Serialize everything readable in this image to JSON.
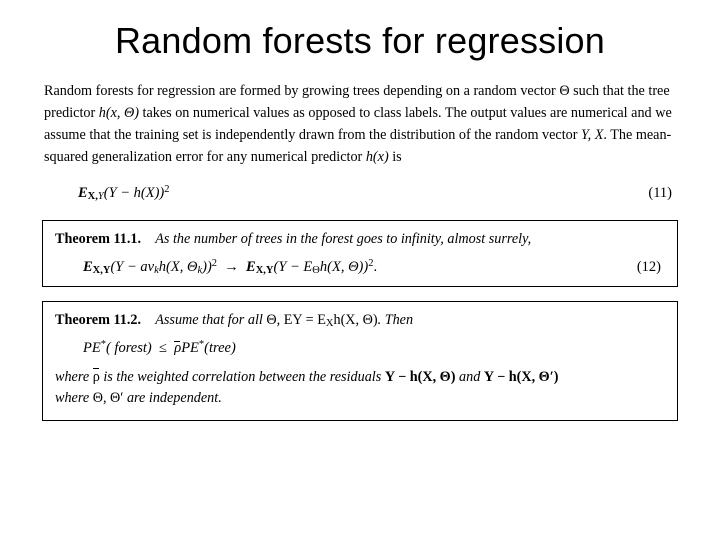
{
  "title": "Random forests for regression",
  "intro": {
    "line1_pre": "Random forests for regression are formed by growing trees depending on a random vector ",
    "theta1": "Θ",
    "line1_mid": " such that the tree predictor ",
    "hxTheta": "h(x, Θ)",
    "line1_post": " takes on numerical values as opposed to class labels. The output values are numerical and we assume that the training set is independently drawn from the distribution of the random vector ",
    "YX": "Y, X",
    "line1_post2": ". The mean-squared generalization error for any numerical predictor ",
    "hx": "h(x)",
    "line1_end": " is"
  },
  "eq11": {
    "lhs_E": "E",
    "lhs_sub1": "X,",
    "lhs_sub2": "Y",
    "body": "(Y − h(X))",
    "sq": "2",
    "num": "(11)"
  },
  "thm11": {
    "label": "Theorem 11.1.",
    "stmt": "As the number of trees in the forest goes to infinity, almost surrely,",
    "eq_lhs_E": "E",
    "eq_lhs_sub": "X,Y",
    "eq_lhs_body": "(Y − av",
    "eq_lhs_k": "k",
    "eq_lhs_body2": "h(X, Θ",
    "eq_lhs_k2": "k",
    "eq_lhs_body3": "))",
    "eq_lhs_sq": "2",
    "arrow": "→",
    "eq_rhs_E": "E",
    "eq_rhs_sub": "X,Y",
    "eq_rhs_body": "(Y − E",
    "eq_rhs_Thsub": "Θ",
    "eq_rhs_body2": "h(X, Θ))",
    "eq_rhs_sq": "2",
    "eq_rhs_end": ".",
    "num": "(12)"
  },
  "thm12": {
    "label": "Theorem 11.2.",
    "stmt_pre": "Assume that for all ",
    "theta": "Θ",
    "stmt_mid": ", ",
    "EY": "EY = E",
    "EY_sub": "X",
    "EY_post": "h(X, Θ)",
    "stmt_post": ". Then",
    "eq_PE": "PE",
    "eq_star": "*",
    "eq_forest": "( forest)",
    "eq_le": "≤",
    "eq_rho": "ρ",
    "eq_PE2": "PE",
    "eq_star2": "*",
    "eq_tree": "(tree)",
    "where_pre": "where ",
    "where_rho": "ρ",
    "where_mid": " is the weighted correlation between the residuals ",
    "where_res1": "Y − h(X, Θ)",
    "where_and": " and ",
    "where_res2": "Y − h(X, Θ′)",
    "where_line2_pre": "where ",
    "where_Th": "Θ",
    "where_comma": ", ",
    "where_Thp": "Θ′",
    "where_end": " are independent."
  }
}
